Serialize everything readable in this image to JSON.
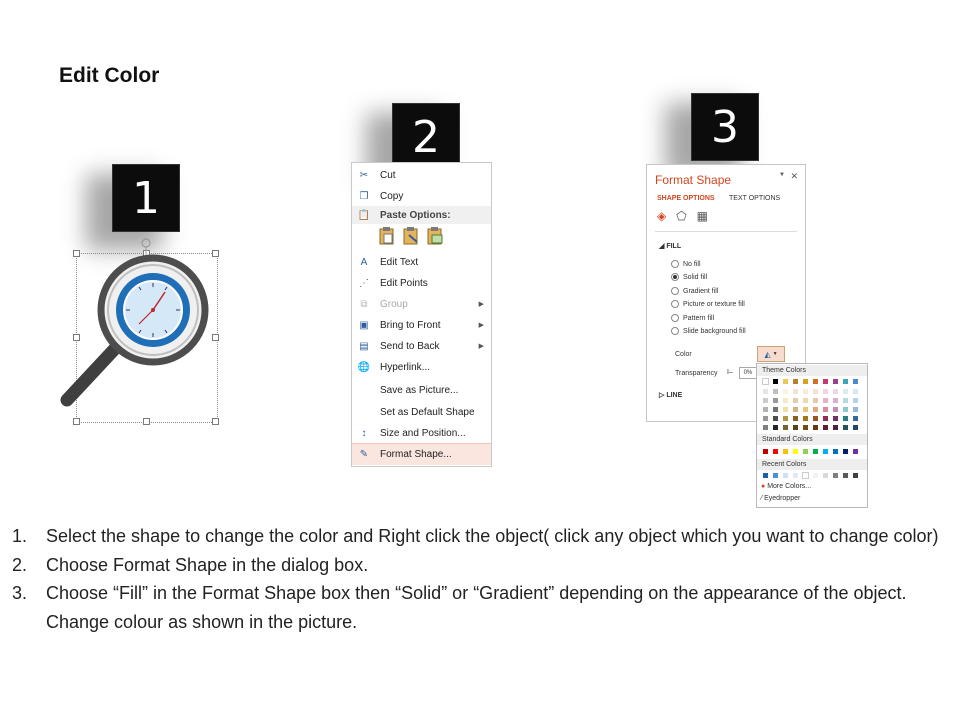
{
  "slide": {
    "title": "Edit Color"
  },
  "badges": [
    "1",
    "2",
    "3"
  ],
  "context_menu": {
    "items": [
      {
        "label": "Cut",
        "icon": "scissors-icon",
        "state": "normal"
      },
      {
        "label": "Copy",
        "icon": "copy-icon",
        "state": "normal"
      },
      {
        "label": "Paste Options:",
        "icon": "paste-icon",
        "state": "header"
      },
      {
        "label": "Edit Text",
        "icon": "edit-text-icon",
        "state": "normal"
      },
      {
        "label": "Edit Points",
        "icon": "edit-points-icon",
        "state": "normal"
      },
      {
        "label": "Group",
        "icon": "group-icon",
        "state": "disabled"
      },
      {
        "label": "Bring to Front",
        "icon": "bring-to-front-icon",
        "state": "normal"
      },
      {
        "label": "Send to Back",
        "icon": "send-to-back-icon",
        "state": "normal"
      },
      {
        "label": "Hyperlink...",
        "icon": "hyperlink-icon",
        "state": "normal"
      },
      {
        "label": "Save as Picture...",
        "icon": "",
        "state": "normal"
      },
      {
        "label": "Set as Default Shape",
        "icon": "",
        "state": "normal"
      },
      {
        "label": "Size and Position...",
        "icon": "size-position-icon",
        "state": "normal"
      },
      {
        "label": "Format Shape...",
        "icon": "format-shape-icon",
        "state": "highlighted"
      }
    ]
  },
  "format_pane": {
    "title": "Format Shape",
    "tabs": [
      "SHAPE OPTIONS",
      "TEXT OPTIONS"
    ],
    "fill_section": "FILL",
    "fill_options": [
      "No fill",
      "Solid fill",
      "Gradient fill",
      "Picture or texture fill",
      "Pattern fill",
      "Slide background fill"
    ],
    "selected_fill": "Solid fill",
    "color_label": "Color",
    "transparency_label": "Transparency",
    "transparency_value": "0%",
    "line_section": "LINE",
    "accent_color": "#d2461e"
  },
  "color_palette": {
    "theme_label": "Theme Colors",
    "standard_label": "Standard Colors",
    "recent_label": "Recent Colors",
    "more_colors": "More Colors...",
    "eyedropper": "Eyedropper",
    "theme_top": [
      "#ffffff",
      "#000000",
      "#e8c95a",
      "#b5802e",
      "#d6a020",
      "#cf6f2a",
      "#c43a6b",
      "#9b3f8a",
      "#3fa5b5",
      "#4b8bc9"
    ],
    "standard": [
      "#c00000",
      "#ff0000",
      "#ffc000",
      "#ffff00",
      "#92d050",
      "#00b050",
      "#00b0f0",
      "#0070c0",
      "#002060",
      "#7030a0"
    ],
    "recent": [
      "#1f5fa8",
      "#4a90d9",
      "#cfe0f2",
      "#dfe9f5",
      "#ffffff",
      "#f2f2f2",
      "#d9d9d9",
      "#7f7f7f",
      "#595959",
      "#404040"
    ]
  },
  "instructions": [
    {
      "num": "1.",
      "text": "Select the shape to change the color and Right click the object( click any object which you want to change color)"
    },
    {
      "num": "2.",
      "text": "Choose Format Shape in the dialog box."
    },
    {
      "num": "3.",
      "text": "Choose “Fill” in the Format Shape box then “Solid” or “Gradient” depending on the appearance of the object. Change colour as shown in the picture."
    }
  ]
}
